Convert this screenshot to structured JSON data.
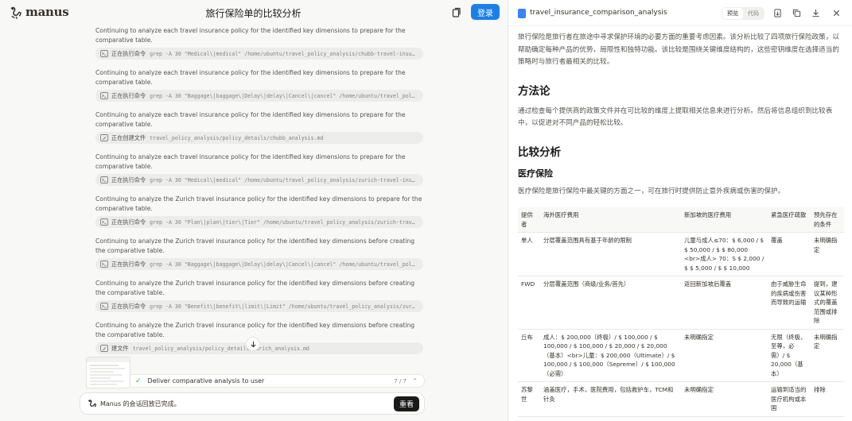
{
  "app": {
    "name": "manus",
    "title": "旅行保险单的比较分析",
    "login_label": "登录"
  },
  "feed": {
    "items": [
      {
        "msg": "Continuing to analyze each travel insurance policy for the identified key dimensions to prepare for the comparative table.",
        "action": "正在执行命令",
        "arg": "grep -A 30 \"Medical\\|medical\" /home/ubuntu/travel_policy_analysis/chubb-travel-insurance…",
        "icon": "terminal"
      },
      {
        "msg": "Continuing to analyze each travel insurance policy for the identified key dimensions to prepare for the comparative table.",
        "action": "正在执行命令",
        "arg": "grep -A 30 \"Baggage\\|baggage\\|Delay\\|delay\\|Cancel\\|cancel\" /home/ubuntu/travel_policy_a…",
        "icon": "terminal"
      },
      {
        "msg": "Continuing to analyze each travel insurance policy for the identified key dimensions to prepare for the comparative table.",
        "action": "正在创建文件",
        "arg": "travel_policy_analysis/policy_details/chubb_analysis.md",
        "icon": "edit"
      },
      {
        "msg": "Continuing to analyze each travel insurance policy for the identified key dimensions to prepare for the comparative table.",
        "action": "正在执行命令",
        "arg": "grep -A 30 \"Medical\\|medical\" /home/ubuntu/travel_policy_analysis/zurich-travel-insuranc…",
        "icon": "terminal"
      },
      {
        "msg": "Continuing to analyze the Zurich travel insurance policy for the identified key dimensions to prepare for the comparative table.",
        "action": "正在执行命令",
        "arg": "grep -A 30 \"Plan\\|plan\\|tier\\|Tier\" /home/ubuntu/travel_policy_analysis/zurich-travel-in…",
        "icon": "terminal"
      },
      {
        "msg": "Continuing to analyze the Zurich travel insurance policy for the identified key dimensions before creating the comparative table.",
        "action": "正在执行命令",
        "arg": "grep -A 30 \"Baggage\\|baggage\\|Delay\\|delay\\|Cancel\\|cancel\" /home/ubuntu/travel_policy_a…",
        "icon": "terminal"
      },
      {
        "msg": "Continuing to analyze the Zurich travel insurance policy for the identified key dimensions before creating the comparative table.",
        "action": "正在执行命令",
        "arg": "grep -A 30 \"Benefit\\|benefit\\|limit\\|Limit\" /home/ubuntu/travel_policy_analysis/zurich-t…",
        "icon": "terminal"
      },
      {
        "msg": "Continuing to analyze the Zurich travel insurance policy for the identified key dimensions before creating the comparative table.",
        "action": "建文件",
        "arg": "travel_policy_analysis/policy_details/zurich_analysis.md",
        "icon": "edit"
      }
    ]
  },
  "task": {
    "label": "Deliver comparative analysis to user",
    "count": "7 / 7"
  },
  "status": {
    "text": "Manus 的会话回放已完成。",
    "button": "重看"
  },
  "panel": {
    "filename": "travel_insurance_comparison_analysis",
    "tab_preview": "预览",
    "tab_code": "代码",
    "intro": "旅行保险是旅行者在旅途中寻求保护环境的必要方面的重要考虑因素。该分析比较了四项旅行保险政策，以帮助确定每种产品的优势，局限性和独特功能。该比较是围绕关键维度结构的，这些密钥维度在选择适当的策略时与旅行者最相关的比较。",
    "h_method": "方法论",
    "method": "通过检查每个提供商的政策文件并在可比较的维度上提取相关信息来进行分析。然后将信息组织到比较表中，以促进对不同产品的轻松比较。",
    "h_compare": "比较分析",
    "h_medical": "医疗保险",
    "medical": "医疗保险是旅行保险中最关键的方面之一，可在旅行时提供防止意外疾病或伤害的保护。",
    "table": {
      "headers": [
        "提供者",
        "海外医疗费用",
        "新加坡的医疗费用",
        "紧急医疗疏散",
        "预先存在的条件"
      ],
      "rows": [
        [
          "单人",
          "分层覆盖范围具有基于年龄的限制",
          "儿童与成人≤70：$ 6,000 / $ $ 50,000 / $ $ 80,000 <br>成人> 70：S $ 2,000 / $ $ 5,000 / $ $ 10,000",
          "覆盖",
          "未明确指定"
        ],
        [
          "FWD",
          "分层覆盖范围（商级/业务/首先）",
          "返回新加坡后覆盖",
          "由于威胁生命的疾病或伤害而导致的运输",
          "提到，建议某种形式的覆盖范围或排除"
        ],
        [
          "丘布",
          "成人：$ 200,000（终极）/ $ 100,000 / $ 100,000 / $ 100,000 / $ 20,000 / $ 20,000（基本）<br>儿童：$ 200,000（Ultimate）/ $ 100,000 / $ 100,000（Sepreme）/ $ 100,000（必需）",
          "未明确指定",
          "无限（终极，至尊，必需）/ $ 20,000（基本）",
          "未明确指定"
        ],
        [
          "苏黎世",
          "涵盖医疗，手术，医院费用，包括救护车，TCM和针灸",
          "未明确指定",
          "运输到适当的医疗机构或本国",
          "排除"
        ]
      ]
    }
  }
}
